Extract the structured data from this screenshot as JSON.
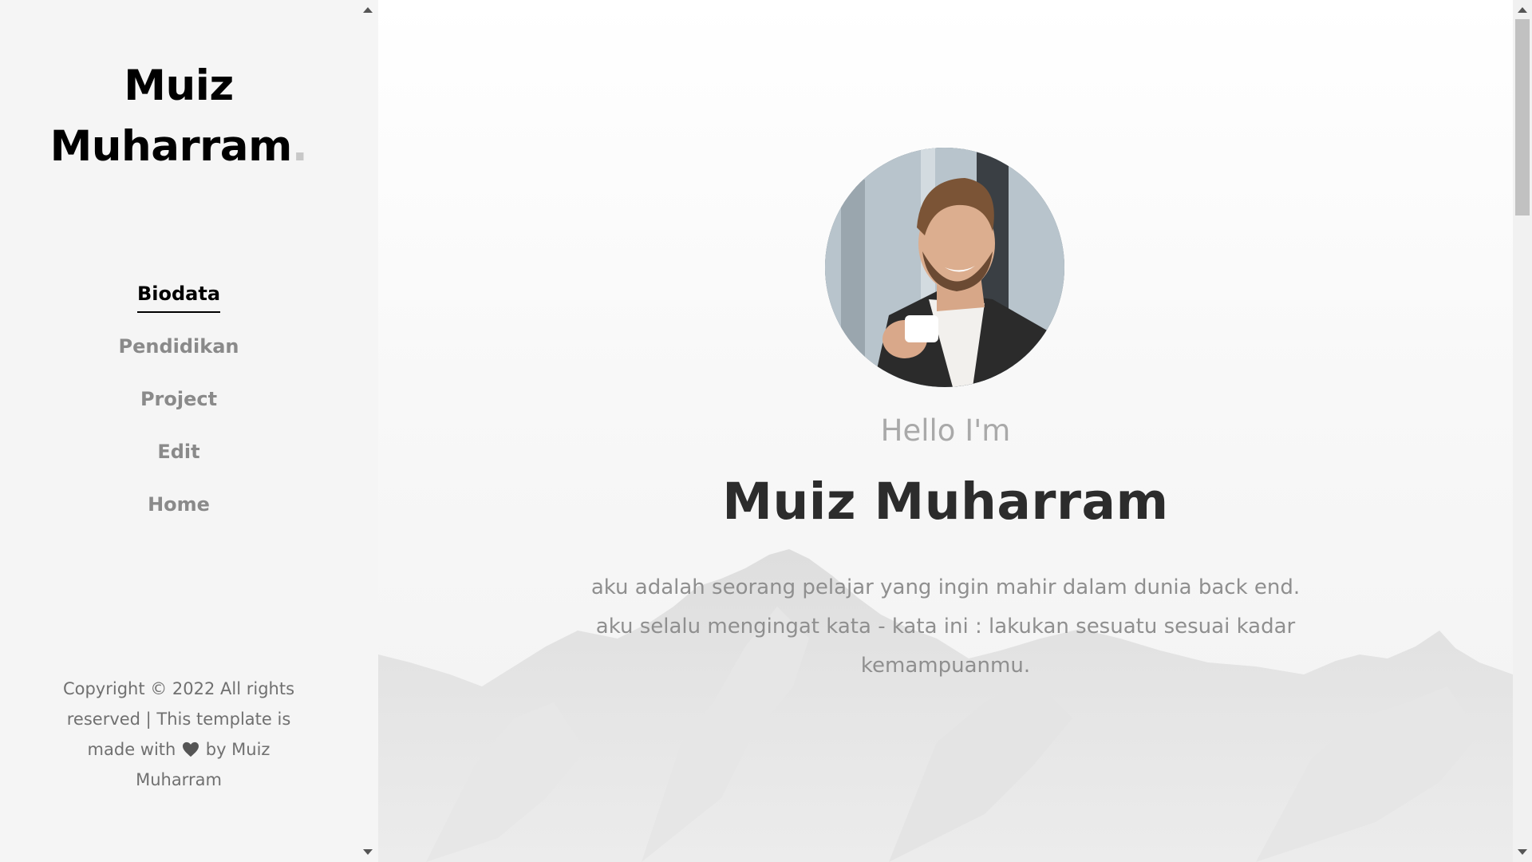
{
  "sidebar": {
    "brand_line1": "Muiz",
    "brand_line2": "Muharram",
    "brand_dot": ".",
    "menu": [
      {
        "label": "Biodata",
        "active": true
      },
      {
        "label": "Pendidikan",
        "active": false
      },
      {
        "label": "Project",
        "active": false
      },
      {
        "label": "Edit",
        "active": false
      },
      {
        "label": "Home",
        "active": false
      }
    ],
    "footer_before_heart": "Copyright © 2022 All rights reserved | This template is made with",
    "footer_after_heart": "by Muiz Muharram"
  },
  "main": {
    "greeting": "Hello I'm",
    "name": "Muiz Muharram",
    "bio": "aku adalah seorang pelajar yang ingin mahir dalam dunia back end. aku selalu mengingat kata - kata ini : lakukan sesuatu sesuai kadar kemampuanmu."
  },
  "icons": {
    "heart": "heart-icon",
    "avatar": "avatar-photo"
  },
  "colors": {
    "sidebar_bg": "#f5f5f5",
    "active_menu": "#000000",
    "inactive_menu": "#8a8a8a",
    "hero_name": "#2c2c2c",
    "greeting": "#a9a9a9",
    "bio": "#8f8f8f"
  }
}
